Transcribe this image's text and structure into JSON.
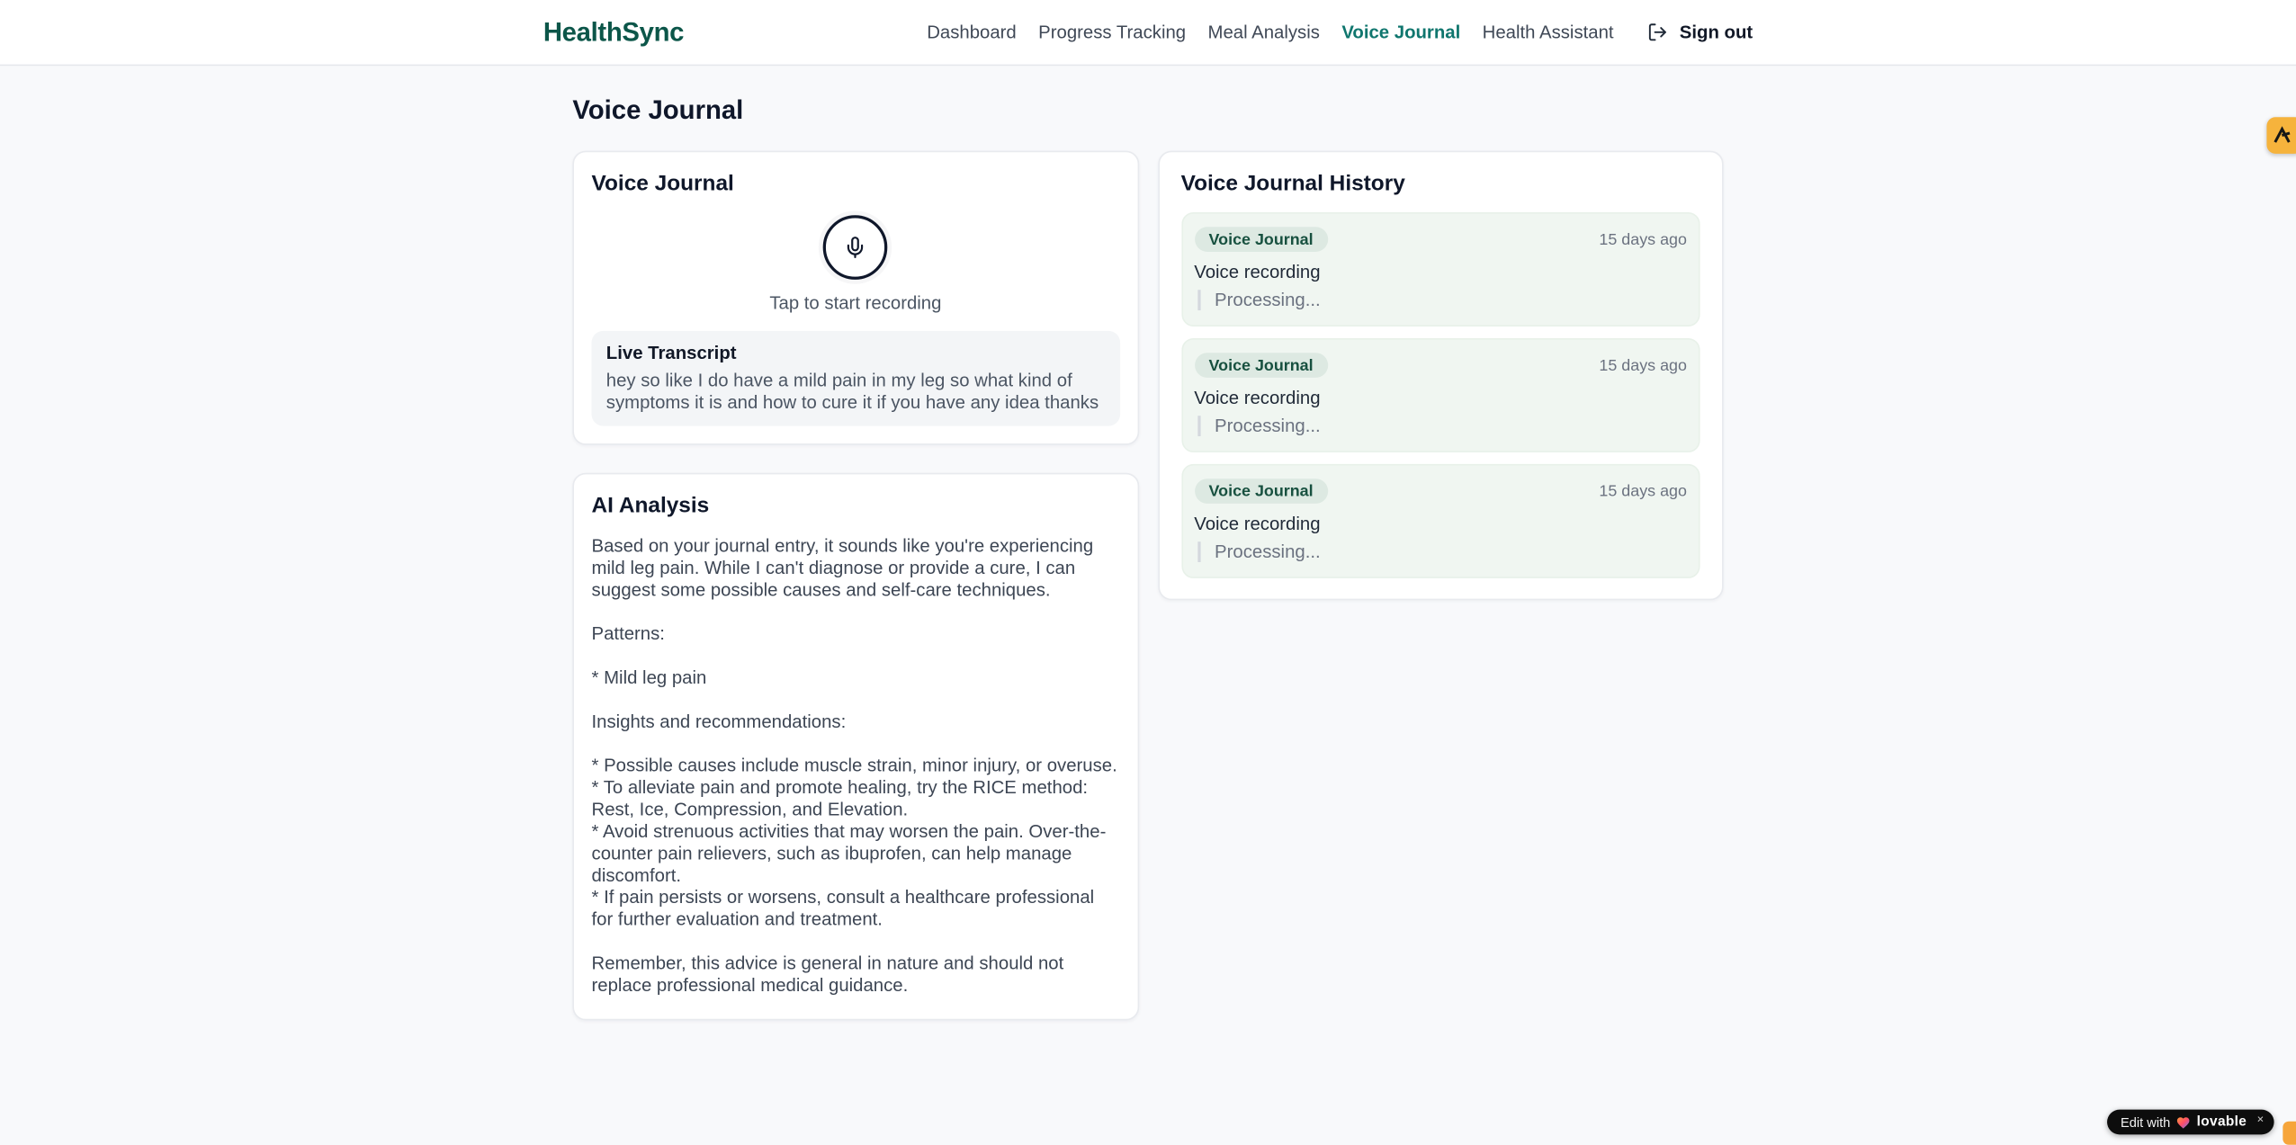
{
  "brand": {
    "name": "HealthSync"
  },
  "nav": {
    "items": [
      {
        "label": "Dashboard",
        "active": false
      },
      {
        "label": "Progress Tracking",
        "active": false
      },
      {
        "label": "Meal Analysis",
        "active": false
      },
      {
        "label": "Voice Journal",
        "active": true
      },
      {
        "label": "Health Assistant",
        "active": false
      }
    ],
    "sign_out": "Sign out"
  },
  "page": {
    "title": "Voice Journal"
  },
  "recorder": {
    "title": "Voice Journal",
    "hint": "Tap to start recording",
    "live_transcript": {
      "title": "Live Transcript",
      "text": "hey so like I do have a mild pain in my leg so what kind of symptoms it is and how to cure it if you have any idea thanks"
    }
  },
  "analysis": {
    "title": "AI Analysis",
    "body": "Based on your journal entry, it sounds like you're experiencing mild leg pain. While I can't diagnose or provide a cure, I can suggest some possible causes and self-care techniques.\n\nPatterns:\n\n* Mild leg pain\n\nInsights and recommendations:\n\n* Possible causes include muscle strain, minor injury, or overuse.\n* To alleviate pain and promote healing, try the RICE method: Rest, Ice, Compression, and Elevation.\n* Avoid strenuous activities that may worsen the pain. Over-the-counter pain relievers, such as ibuprofen, can help manage discomfort.\n* If pain persists or worsens, consult a healthcare professional for further evaluation and treatment.\n\nRemember, this advice is general in nature and should not replace professional medical guidance."
  },
  "history": {
    "title": "Voice Journal History",
    "entries": [
      {
        "badge": "Voice Journal",
        "time": "15 days ago",
        "label": "Voice recording",
        "status": "Processing..."
      },
      {
        "badge": "Voice Journal",
        "time": "15 days ago",
        "label": "Voice recording",
        "status": "Processing..."
      },
      {
        "badge": "Voice Journal",
        "time": "15 days ago",
        "label": "Voice recording",
        "status": "Processing..."
      }
    ]
  },
  "floating": {
    "edit_badge": {
      "prefix": "Edit with",
      "brand": "lovable",
      "close": "×"
    }
  },
  "icons": {
    "microphone": "mic-icon",
    "sign_out": "log-out-icon",
    "heart": "heart-icon",
    "close": "close-icon",
    "side_logo": "lambda-logo-icon"
  },
  "colors": {
    "brand_logo": "#0c5649",
    "nav_active": "#0f766e",
    "entry_bg": "#f0f6f1",
    "badge_bg": "#dde9e2",
    "badge_text": "#17503f",
    "amber_widget": "#f6b33c",
    "lovable_pill": "#0d0d0d",
    "page_bg": "#f8f9fb"
  }
}
